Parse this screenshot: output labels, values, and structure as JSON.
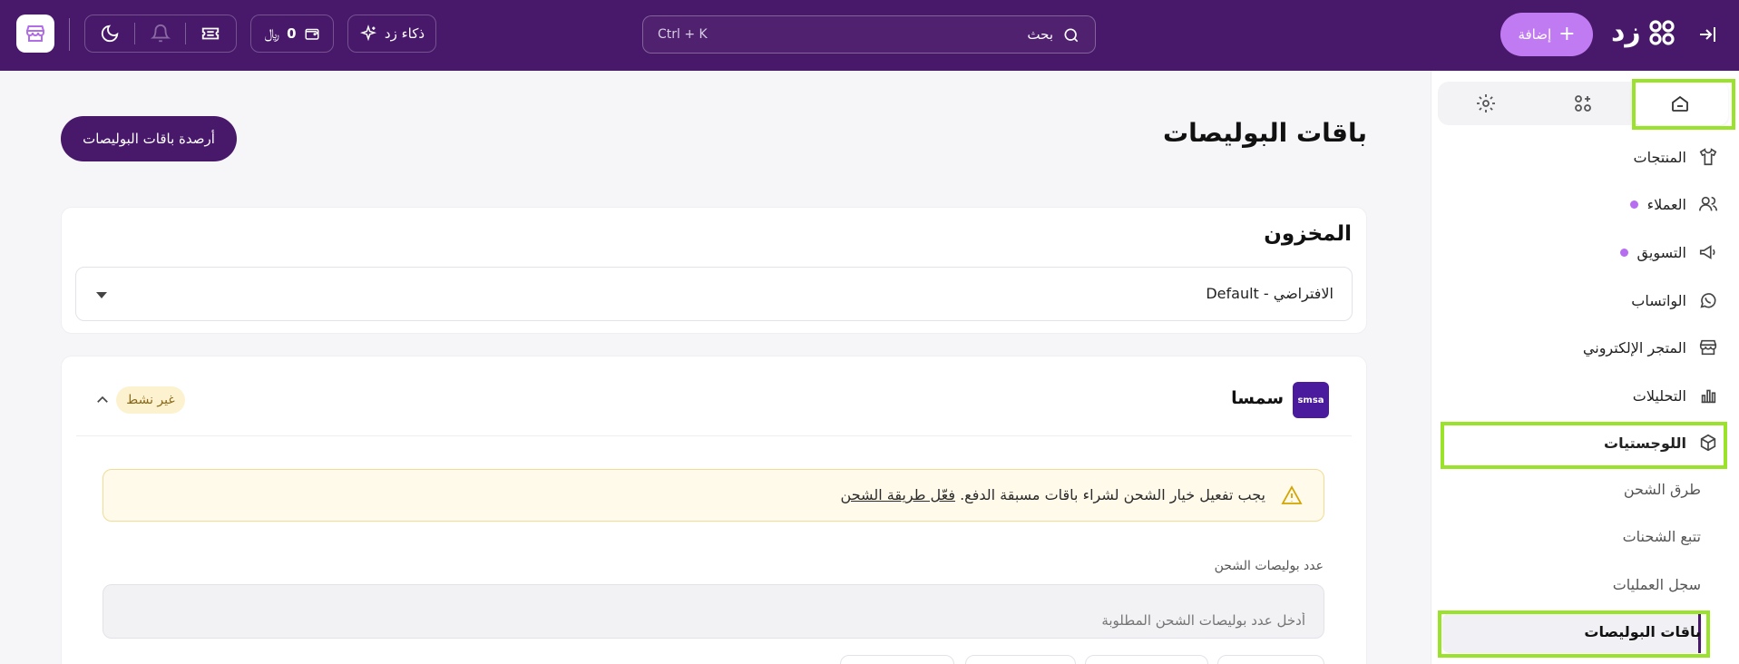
{
  "topbar": {
    "search_label": "بحث",
    "search_placeholder": "Ctrl + K",
    "ai_label": "ذكاء زد",
    "wallet_value": "0",
    "add_label": "إضافة",
    "brand": "زد"
  },
  "sidebar": {
    "items": [
      {
        "label": "المنتجات",
        "icon": "shirt-icon",
        "dot": false
      },
      {
        "label": "العملاء",
        "icon": "users-icon",
        "dot": true
      },
      {
        "label": "التسويق",
        "icon": "megaphone-icon",
        "dot": true
      },
      {
        "label": "الواتساب",
        "icon": "whatsapp-icon",
        "dot": false
      },
      {
        "label": "المتجر الإلكتروني",
        "icon": "store-icon",
        "dot": false
      },
      {
        "label": "التحليلات",
        "icon": "chart-icon",
        "dot": false
      },
      {
        "label": "اللوجستيات",
        "icon": "box-icon",
        "dot": false
      }
    ],
    "logistics_sub": [
      "طرق الشحن",
      "تتبع الشحنات",
      "سجل العمليات",
      "باقات البوليصات"
    ]
  },
  "main": {
    "page_title": "باقات البوليصات",
    "balance_button": "أرصدة باقات البوليصات",
    "warehouse_title": "المخزون",
    "warehouse_value": "Default - الافتراضي",
    "provider_name": "سمسا",
    "provider_logo_text": "smsa",
    "status": "غير نشط",
    "warning_text": "يجب تفعيل خيار الشحن لشراء باقات مسبقة الدفع.",
    "warning_link": "فعّل طريقة الشحن",
    "field_label": "عدد بوليصات الشحن",
    "field_placeholder": "أدخل عدد بوليصات الشحن المطلوبة"
  },
  "colors": {
    "brand_purple": "#48186a",
    "accent_purple": "#c17bf2",
    "highlight_green": "#9be22b"
  }
}
